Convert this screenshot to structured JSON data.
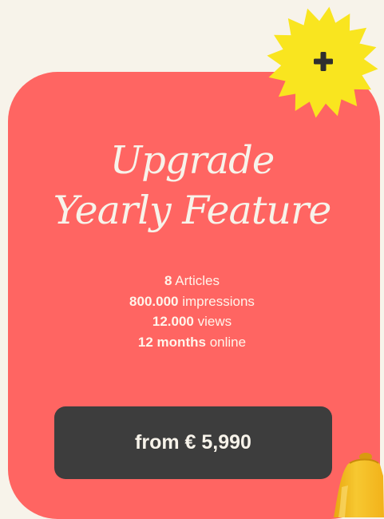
{
  "colors": {
    "background": "#f7f3ea",
    "card": "#ff6562",
    "starburst": "#f9e51f",
    "button": "#3d3d3d",
    "text_light": "#f7f3ea"
  },
  "badge": {
    "icon": "plus-icon"
  },
  "title": {
    "line1": "Upgrade",
    "line2": "Yearly Feature"
  },
  "stats": [
    {
      "value": "8",
      "label": "Articles"
    },
    {
      "value": "800.000",
      "label": "impressions"
    },
    {
      "value": "12.000",
      "label": "views"
    },
    {
      "value": "12 months",
      "label": "online"
    }
  ],
  "price_button": {
    "label": "from € 5,990"
  },
  "decoration": {
    "icon": "bell-icon"
  }
}
